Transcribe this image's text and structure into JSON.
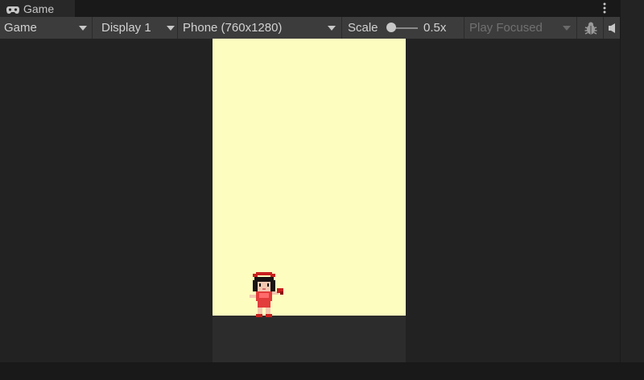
{
  "window": {
    "tab_label": "Game",
    "tab_icon": "gamepad-icon",
    "menu_icon": "kebab-menu-icon"
  },
  "toolbar": {
    "view_mode": "Game",
    "display": "Display 1",
    "resolution": "Phone (760x1280)",
    "scale_label": "Scale",
    "scale_value": "0.5x",
    "play_mode": "Play Focused",
    "debug_icon": "bug-icon",
    "audio_icon": "speaker-icon"
  },
  "scene": {
    "background_color": "#fdfdc0",
    "ground_color": "#2c2c2c",
    "character": "pixel-girl-sprite"
  }
}
